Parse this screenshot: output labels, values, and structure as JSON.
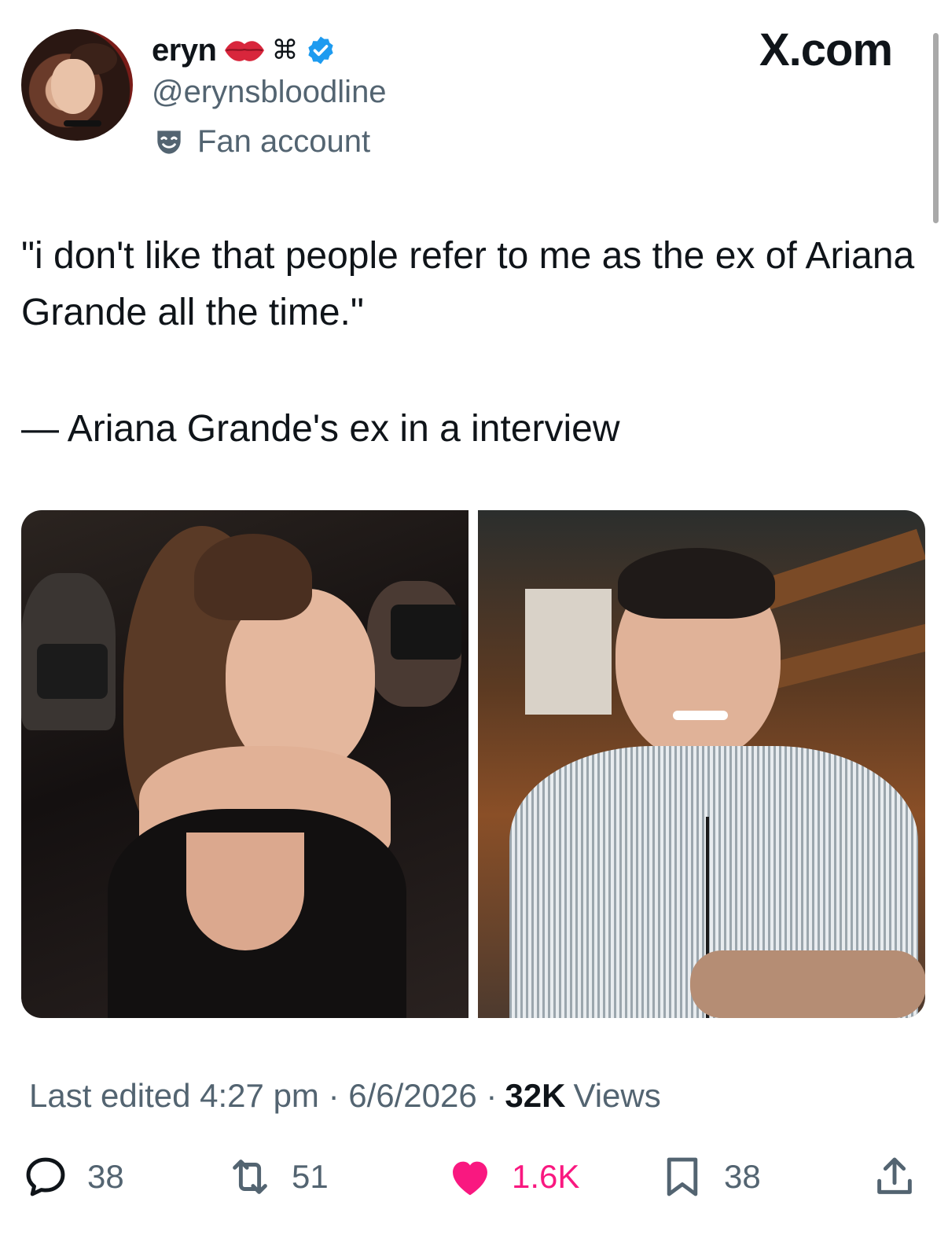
{
  "header": {
    "display_name": "eryn",
    "emoji_icon": "lips-icon",
    "symbol": "⌘",
    "handle": "@erynsbloodline",
    "label": "Fan account",
    "brand": "X.com"
  },
  "tweet": {
    "text": "\"i don't like that people refer to me as the ex of Ariana Grande all the time.\"",
    "attribution": "— Ariana Grande's ex in a interview"
  },
  "meta": {
    "edited": "Last edited 4:27 pm · 6/6/2026 ·",
    "views_count": "32K",
    "views_label": "Views"
  },
  "actions": {
    "replies": "38",
    "reposts": "51",
    "likes": "1.6K",
    "bookmarks": "38"
  },
  "colors": {
    "text": "#0f1419",
    "secondary": "#536471",
    "verified": "#1d9bf0",
    "like": "#f91880"
  }
}
